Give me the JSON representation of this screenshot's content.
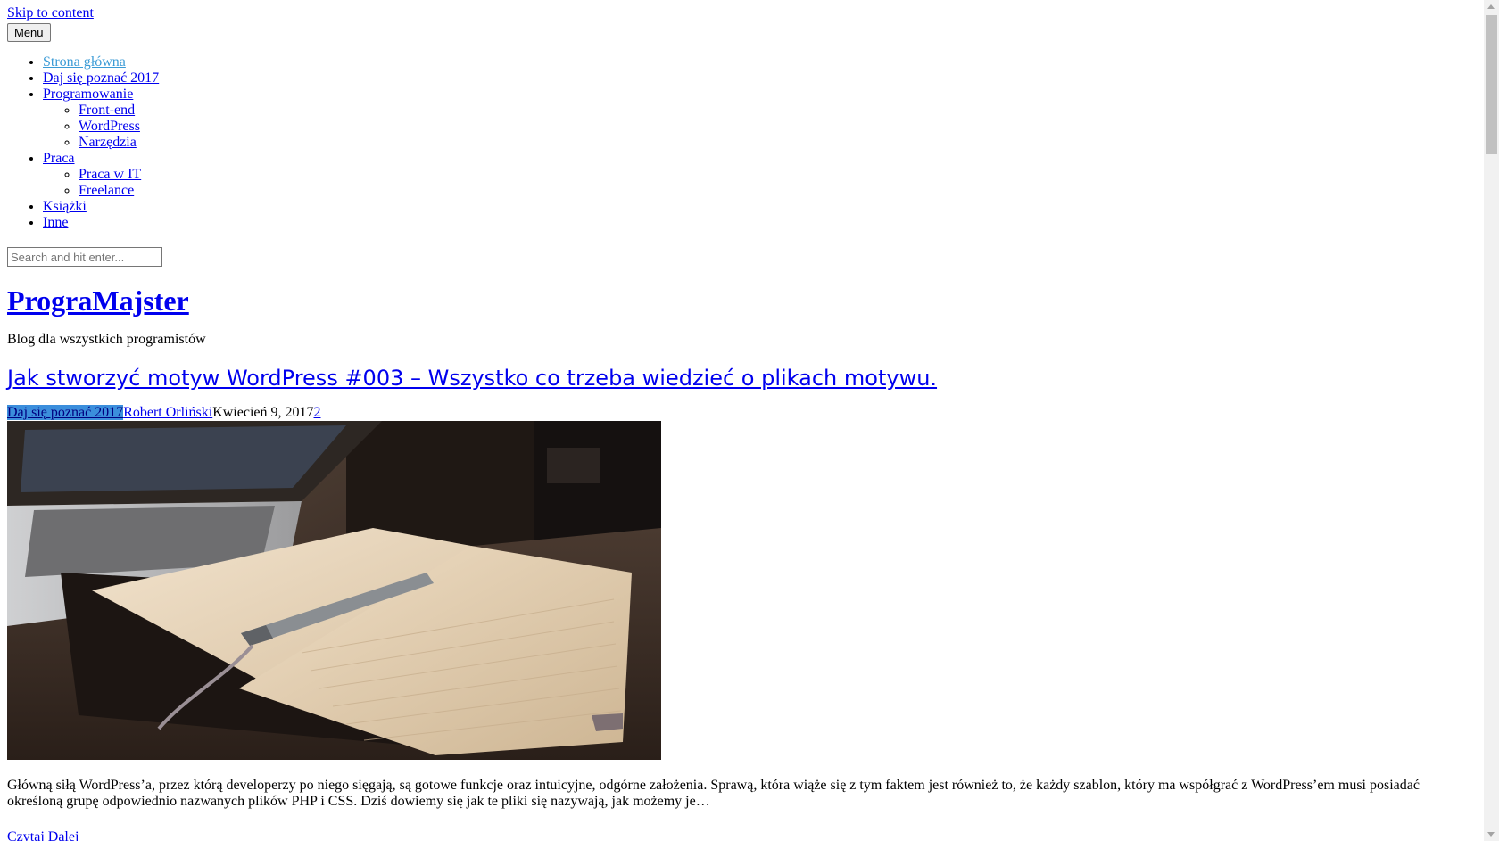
{
  "skip_link": "Skip to content",
  "menu_button": "Menu",
  "nav": {
    "items": [
      {
        "label": "Strona główna"
      },
      {
        "label": "Daj się poznać 2017"
      },
      {
        "label": "Programowanie",
        "children": [
          {
            "label": "Front-end"
          },
          {
            "label": "WordPress"
          },
          {
            "label": "Narzędzia"
          }
        ]
      },
      {
        "label": "Praca",
        "children": [
          {
            "label": "Praca w IT"
          },
          {
            "label": "Freelance"
          }
        ]
      },
      {
        "label": "Książki"
      },
      {
        "label": "Inne"
      }
    ]
  },
  "search": {
    "placeholder": "Search and hit enter..."
  },
  "site": {
    "title": "PrograMajster",
    "description": "Blog dla wszystkich programistów"
  },
  "post": {
    "title": "Jak stworzyć motyw WordPress #003 – Wszystko co trzeba wiedzieć o plikach motywu.",
    "category": "Daj się poznać 2017",
    "author": "Robert Orliński",
    "date": "Kwiecień 9, 2017",
    "comments": "2",
    "excerpt": "Główną siłą WordPress’a, przez którą developerzy po niego sięgają, są gotowe funkcje oraz intuicyjne, odgórne założenia. Sprawą, która wiąże się z tym faktem jest również to, że każdy szablon, który ma współgrać z WordPress’em musi posiadać określoną grupę odpowiednio nazwanych plików PHP i CSS. Dziś dowiemy się jak te pliki się nazywają, jak możemy je…",
    "read_more": "Czytaj Dalej"
  },
  "colors": {
    "link": "#0000ee",
    "visited_link": "#3b9bd6",
    "selection": "#3b8edc"
  }
}
